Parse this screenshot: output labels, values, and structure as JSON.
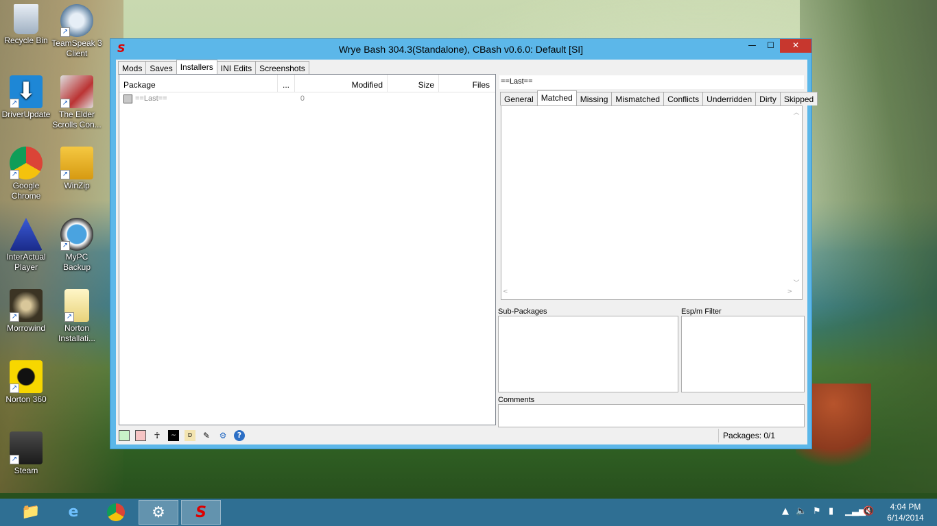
{
  "desktop": {
    "icons": [
      {
        "label": "Recycle Bin"
      },
      {
        "label": "TeamSpeak 3 Client"
      },
      {
        "label": "DriverUpdate"
      },
      {
        "label": "The Elder Scrolls Con..."
      },
      {
        "label": "Google Chrome"
      },
      {
        "label": "WinZip"
      },
      {
        "label": "InterActual Player"
      },
      {
        "label": "MyPC Backup"
      },
      {
        "label": "Morrowind"
      },
      {
        "label": "Norton Installati..."
      },
      {
        "label": "Norton 360"
      },
      {
        "label": "Steam"
      }
    ]
  },
  "window": {
    "title": "Wrye Bash 304.3(Standalone), CBash v0.6.0: Default [SI]",
    "min_label": "—",
    "max_label": "☐",
    "close_label": "✕"
  },
  "tabs": [
    {
      "label": "Mods"
    },
    {
      "label": "Saves"
    },
    {
      "label": "Installers"
    },
    {
      "label": "INI Edits"
    },
    {
      "label": "Screenshots"
    }
  ],
  "columns": {
    "package": "Package",
    "dots": "...",
    "modified": "Modified",
    "size": "Size",
    "files": "Files"
  },
  "packages": [
    {
      "name": "==Last==",
      "count": "0"
    }
  ],
  "details": {
    "selected": "==Last==",
    "subtabs": [
      {
        "label": "General"
      },
      {
        "label": "Matched"
      },
      {
        "label": "Missing"
      },
      {
        "label": "Mismatched"
      },
      {
        "label": "Conflicts"
      },
      {
        "label": "Underridden"
      },
      {
        "label": "Dirty"
      },
      {
        "label": "Skipped"
      }
    ],
    "sub_packages_label": "Sub-Packages",
    "esp_filter_label": "Esp/m Filter",
    "comments_label": "Comments"
  },
  "status": {
    "packages": "Packages: 0/1"
  },
  "taskbar": {
    "clock_time": "4:04 PM",
    "clock_date": "6/14/2014"
  },
  "colors": {
    "titlebar": "#5cb7e9",
    "close": "#c7372e",
    "taskbar": "#2f6f93"
  }
}
